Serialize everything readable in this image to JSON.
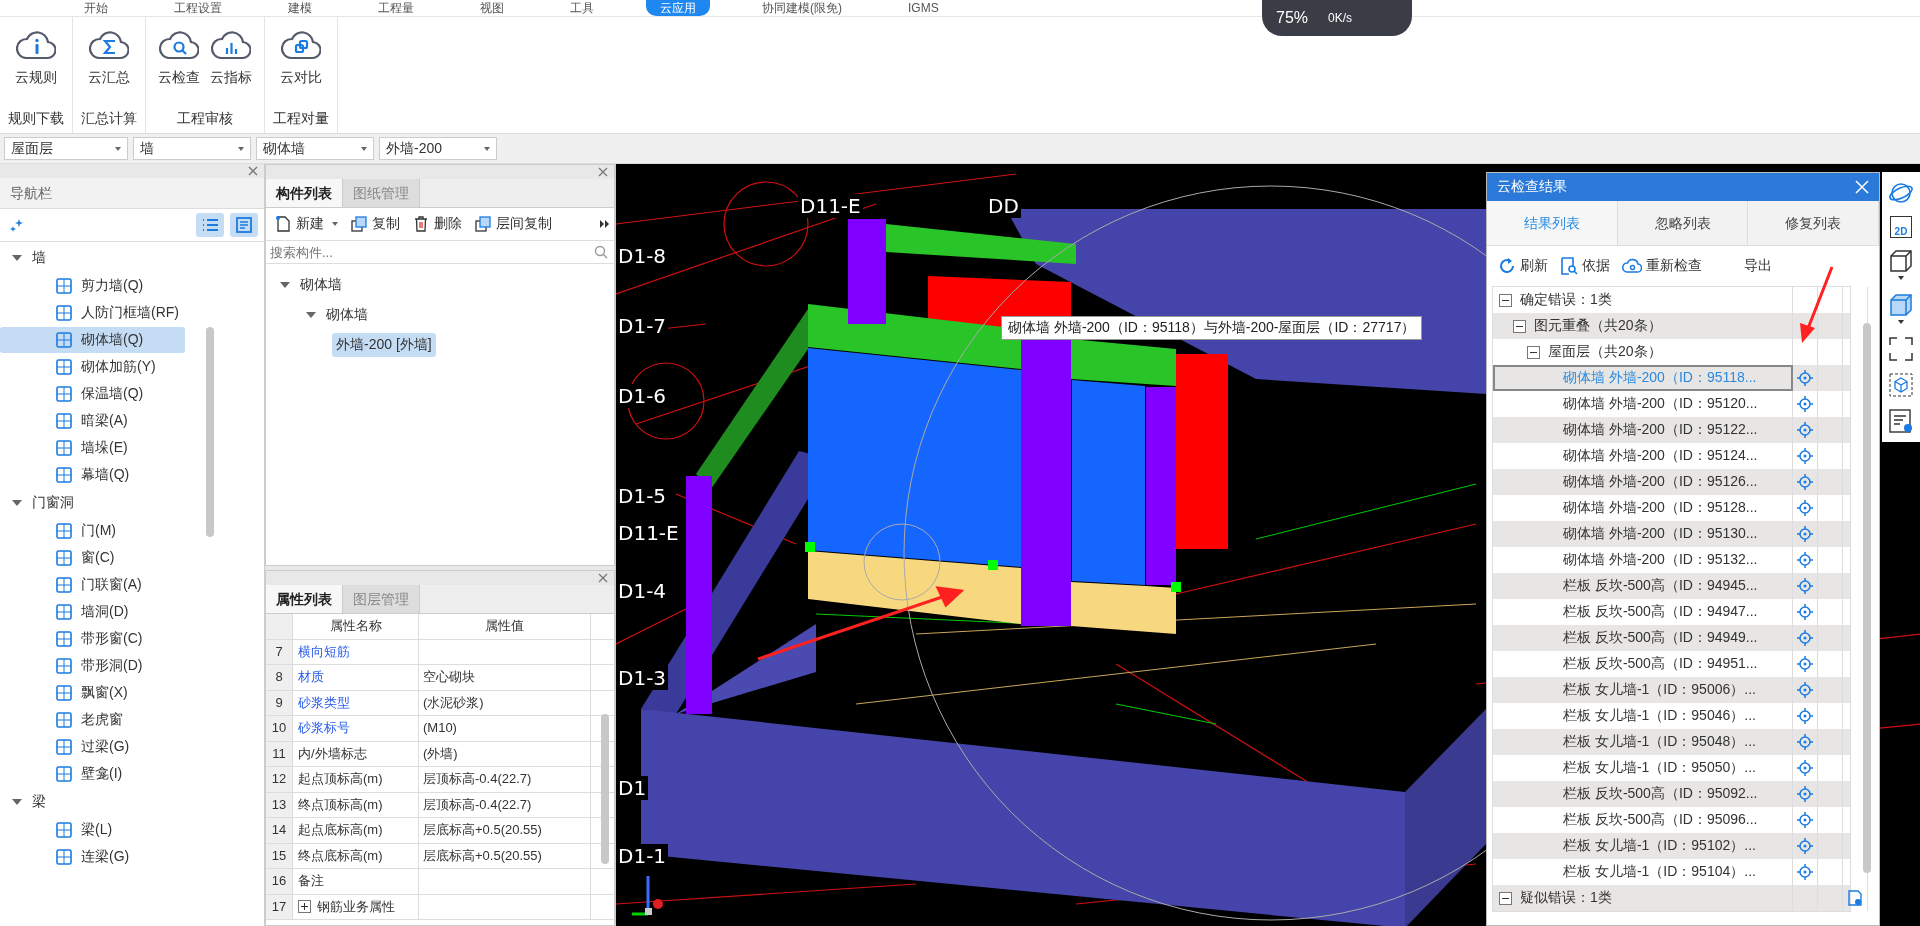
{
  "menu_tabs": [
    {
      "label": "开始",
      "selected": false
    },
    {
      "label": "工程设置",
      "selected": false
    },
    {
      "label": "建模",
      "selected": false
    },
    {
      "label": "工程量",
      "selected": false
    },
    {
      "label": "视图",
      "selected": false
    },
    {
      "label": "工具",
      "selected": false
    },
    {
      "label": "云应用",
      "selected": true
    },
    {
      "label": "协同建模(限免)",
      "selected": false
    },
    {
      "label": "IGMS",
      "selected": false
    }
  ],
  "status_widget": {
    "percent": "75%",
    "speed": "0K/s"
  },
  "ribbon": {
    "groups": [
      {
        "label": "规则下载",
        "buttons": [
          {
            "label": "云规则"
          }
        ]
      },
      {
        "label": "汇总计算",
        "buttons": [
          {
            "label": "云汇总"
          }
        ]
      },
      {
        "label": "工程审核",
        "buttons": [
          {
            "label": "云检查"
          },
          {
            "label": "云指标"
          }
        ]
      },
      {
        "label": "工程对量",
        "buttons": [
          {
            "label": "云对比"
          }
        ]
      }
    ]
  },
  "selectors": [
    "屋面层",
    "墙",
    "砌体墙",
    "外墙-200"
  ],
  "nav": {
    "title": "导航栏",
    "groups": [
      {
        "label": "墙",
        "expanded": true,
        "children": [
          {
            "label": "剪力墙(Q)",
            "selected": false
          },
          {
            "label": "人防门框墙(RF)",
            "selected": false
          },
          {
            "label": "砌体墙(Q)",
            "selected": true
          },
          {
            "label": "砌体加筋(Y)",
            "selected": false
          },
          {
            "label": "保温墙(Q)",
            "selected": false
          },
          {
            "label": "暗梁(A)",
            "selected": false
          },
          {
            "label": "墙垛(E)",
            "selected": false
          },
          {
            "label": "幕墙(Q)",
            "selected": false
          }
        ]
      },
      {
        "label": "门窗洞",
        "expanded": true,
        "children": [
          {
            "label": "门(M)",
            "selected": false
          },
          {
            "label": "窗(C)",
            "selected": false
          },
          {
            "label": "门联窗(A)",
            "selected": false
          },
          {
            "label": "墙洞(D)",
            "selected": false
          },
          {
            "label": "带形窗(C)",
            "selected": false
          },
          {
            "label": "带形洞(D)",
            "selected": false
          },
          {
            "label": "飘窗(X)",
            "selected": false
          },
          {
            "label": "老虎窗",
            "selected": false
          },
          {
            "label": "过梁(G)",
            "selected": false
          },
          {
            "label": "壁龛(I)",
            "selected": false
          }
        ]
      },
      {
        "label": "梁",
        "expanded": true,
        "children": [
          {
            "label": "梁(L)",
            "selected": false
          },
          {
            "label": "连梁(G)",
            "selected": false
          }
        ]
      }
    ]
  },
  "component_panel": {
    "tabs": [
      {
        "label": "构件列表",
        "selected": true
      },
      {
        "label": "图纸管理",
        "selected": false
      }
    ],
    "toolbar": [
      "新建",
      "复制",
      "删除",
      "层间复制"
    ],
    "search": {
      "placeholder": "搜索构件..."
    },
    "tree": [
      {
        "label": "砌体墙",
        "expanded": true,
        "children": [
          {
            "label": "砌体墙",
            "expanded": true,
            "children": [
              {
                "label": "外墙-200 [外墙]",
                "selected": true
              }
            ]
          }
        ]
      }
    ]
  },
  "property_panel": {
    "tabs": [
      {
        "label": "属性列表",
        "selected": true
      },
      {
        "label": "图层管理",
        "selected": false
      }
    ],
    "columns": [
      "属性名称",
      "属性值"
    ],
    "rows": [
      {
        "index": "7",
        "name": "横向短筋",
        "value": "",
        "kind": "link"
      },
      {
        "index": "8",
        "name": "材质",
        "value": "空心砌块",
        "kind": "link"
      },
      {
        "index": "9",
        "name": "砂浆类型",
        "value": "(水泥砂浆)",
        "kind": "link"
      },
      {
        "index": "10",
        "name": "砂浆标号",
        "value": "(M10)",
        "kind": "link"
      },
      {
        "index": "11",
        "name": "内/外墙标志",
        "value": "(外墙)",
        "kind": "plain"
      },
      {
        "index": "12",
        "name": "起点顶标高(m)",
        "value": "层顶标高-0.4(22.7)",
        "kind": "plain"
      },
      {
        "index": "13",
        "name": "终点顶标高(m)",
        "value": "层顶标高-0.4(22.7)",
        "kind": "plain"
      },
      {
        "index": "14",
        "name": "起点底标高(m)",
        "value": "层底标高+0.5(20.55)",
        "kind": "plain"
      },
      {
        "index": "15",
        "name": "终点底标高(m)",
        "value": "层底标高+0.5(20.55)",
        "kind": "plain"
      },
      {
        "index": "16",
        "name": "备注",
        "value": "",
        "kind": "plain"
      },
      {
        "index": "17",
        "name": "钢筋业务属性",
        "value": "",
        "kind": "group"
      }
    ]
  },
  "viewport": {
    "axis_labels": [
      "D11-E",
      "DD",
      "D1-8",
      "D1-7",
      "D1-6",
      "D1-5",
      "D11-E",
      "D1-4",
      "D1-3",
      "D1",
      "D1-1"
    ],
    "tooltip": "砌体墙 外墙-200（ID：95118）与外墙-200-屋面层（ID：27717）"
  },
  "result_panel": {
    "title": "云检查结果",
    "tabs": [
      {
        "label": "结果列表",
        "selected": true
      },
      {
        "label": "忽略列表",
        "selected": false
      },
      {
        "label": "修复列表",
        "selected": false
      }
    ],
    "toolbar": [
      "刷新",
      "依据",
      "重新检查",
      "导出"
    ],
    "tree": [
      {
        "label": "确定错误：1类",
        "expanded": true,
        "children": [
          {
            "label": "图元重叠（共20条）",
            "expanded": true,
            "children": [
              {
                "label": "屋面层（共20条）",
                "expanded": true,
                "children": [
                  {
                    "label": "砌体墙 外墙-200（ID：95118...",
                    "selected": true
                  },
                  {
                    "label": "砌体墙 外墙-200（ID：95120...",
                    "selected": false
                  },
                  {
                    "label": "砌体墙 外墙-200（ID：95122...",
                    "selected": false
                  },
                  {
                    "label": "砌体墙 外墙-200（ID：95124...",
                    "selected": false
                  },
                  {
                    "label": "砌体墙 外墙-200（ID：95126...",
                    "selected": false
                  },
                  {
                    "label": "砌体墙 外墙-200（ID：95128...",
                    "selected": false
                  },
                  {
                    "label": "砌体墙 外墙-200（ID：95130...",
                    "selected": false
                  },
                  {
                    "label": "砌体墙 外墙-200（ID：95132...",
                    "selected": false
                  },
                  {
                    "label": "栏板 反坎-500高（ID：94945...",
                    "selected": false
                  },
                  {
                    "label": "栏板 反坎-500高（ID：94947...",
                    "selected": false
                  },
                  {
                    "label": "栏板 反坎-500高（ID：94949...",
                    "selected": false
                  },
                  {
                    "label": "栏板 反坎-500高（ID：94951...",
                    "selected": false
                  },
                  {
                    "label": "栏板 女儿墙-1（ID：95006）...",
                    "selected": false
                  },
                  {
                    "label": "栏板 女儿墙-1（ID：95046）...",
                    "selected": false
                  },
                  {
                    "label": "栏板 女儿墙-1（ID：95048）...",
                    "selected": false
                  },
                  {
                    "label": "栏板 女儿墙-1（ID：95050）...",
                    "selected": false
                  },
                  {
                    "label": "栏板 反坎-500高（ID：95092...",
                    "selected": false
                  },
                  {
                    "label": "栏板 反坎-500高（ID：95096...",
                    "selected": false
                  },
                  {
                    "label": "栏板 女儿墙-1（ID：95102）...",
                    "selected": false
                  },
                  {
                    "label": "栏板 女儿墙-1（ID：95104）...",
                    "selected": false
                  }
                ]
              }
            ]
          }
        ]
      },
      {
        "label": "疑似错误：1类",
        "expanded": true
      }
    ]
  },
  "view_toolbar": [
    {
      "kind": "orbit"
    },
    {
      "kind": "plan",
      "label": "2D"
    },
    {
      "kind": "cube"
    },
    {
      "kind": "solid"
    },
    {
      "kind": "fit"
    },
    {
      "kind": "wireframe"
    },
    {
      "kind": "list"
    }
  ]
}
